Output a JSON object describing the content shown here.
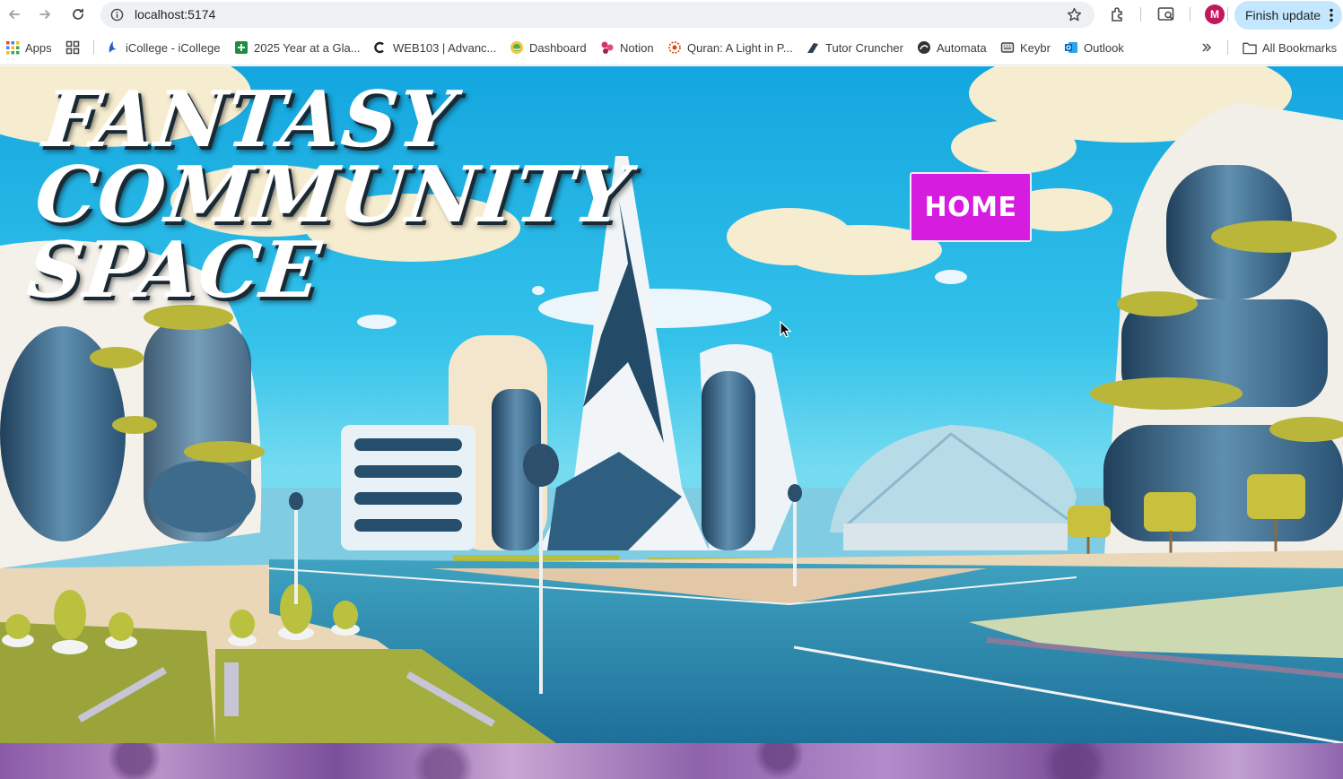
{
  "browser": {
    "url": "localhost:5174",
    "finish_update_label": "Finish update",
    "profile_initial": "M",
    "all_bookmarks_label": "All Bookmarks"
  },
  "bookmarks": [
    {
      "label": "Apps",
      "icon": "apps-grid-icon"
    },
    {
      "label": "iCollege - iCollege",
      "icon": "icollege-icon"
    },
    {
      "label": "2025 Year at a Gla...",
      "icon": "sheets-icon"
    },
    {
      "label": "WEB103 | Advanc...",
      "icon": "codepath-icon"
    },
    {
      "label": "Dashboard",
      "icon": "dashboard-icon"
    },
    {
      "label": "Notion",
      "icon": "notion-icon"
    },
    {
      "label": "Quran: A Light in P...",
      "icon": "quran-icon"
    },
    {
      "label": "Tutor Cruncher",
      "icon": "tutor-cruncher-icon"
    },
    {
      "label": "Automata",
      "icon": "automata-icon"
    },
    {
      "label": "Keybr",
      "icon": "keybr-icon"
    },
    {
      "label": "Outlook",
      "icon": "outlook-icon"
    }
  ],
  "page": {
    "title_line1": "FANTASY COMMUNITY",
    "title_line2": "SPACE",
    "home_button": "HOME"
  },
  "colors": {
    "home_button": "#d61ddf",
    "sky": "#2fb8e6",
    "profile": "#c2185b"
  }
}
